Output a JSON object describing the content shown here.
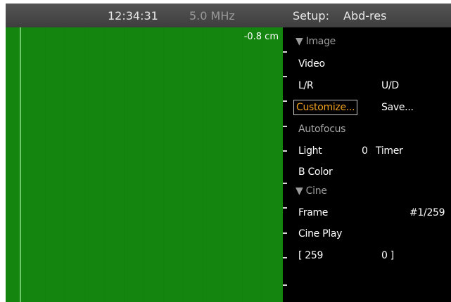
{
  "status_bar": {
    "time": "12:34:31",
    "frequency": "5.0 MHz",
    "setup_label": "Setup:",
    "setup_name": "Abd-res"
  },
  "image_area": {
    "depth_readout": "-0.8 cm",
    "background_color": "#14850f"
  },
  "menu": {
    "image_section": {
      "arrow": "▼",
      "label": "Image"
    },
    "video": "Video",
    "lr": "L/R",
    "ud": "U/D",
    "customize": "Customize...",
    "save": "Save...",
    "autofocus": "Autofocus",
    "light_label": "Light",
    "light_value": "0",
    "timer": "Timer",
    "b_color": "B Color",
    "cine_section": {
      "arrow": "▼",
      "label": "Cine"
    },
    "frame_label": "Frame",
    "frame_value": "#1/259",
    "cine_play": "Cine Play",
    "range_start": "[ 259",
    "range_end": "0 ]"
  },
  "colors": {
    "selected_text": "#f0a020",
    "section_header": "#9c9c9c"
  }
}
